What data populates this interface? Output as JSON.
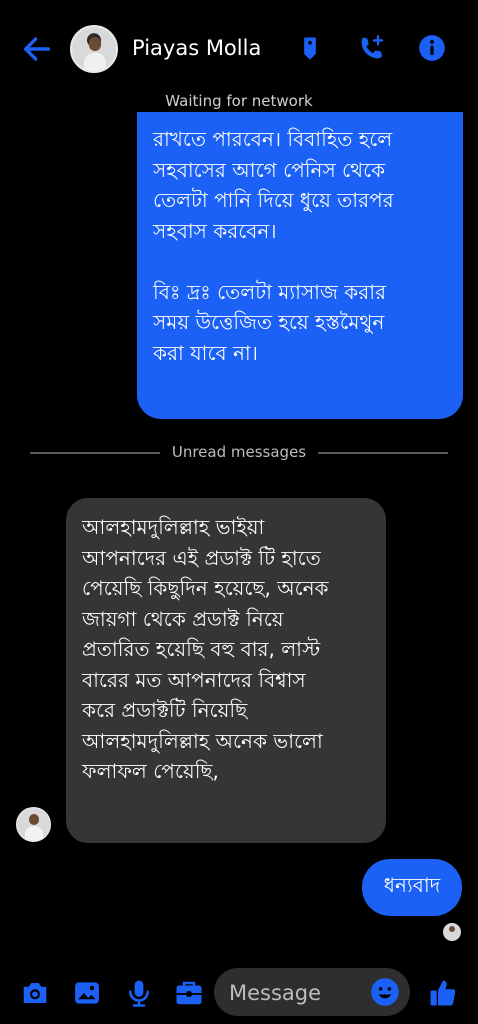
{
  "header": {
    "contact_name": "Piayas Molla",
    "status": "Waiting for network",
    "icons": [
      "back-arrow-icon",
      "tag-icon",
      "call-add-icon",
      "info-icon"
    ]
  },
  "messages": {
    "outgoing_top_text": "রাখতে পারবেন। বিবাহিত হলে\nসহবাসের আগে পেনিস থেকে\nতেলটা পানি দিয়ে ধুয়ে তারপর\nসহবাস করবেন।\n\nবিঃ দ্রঃ তেলটা ম্যাসাজ করার\nসময় উত্তেজিত হয়ে হস্তমৈথুন\nকরা যাবে না।",
    "divider_label": "Unread messages",
    "incoming_text": "আলহামদুলিল্লাহ ভাইয়া\nআপনাদের এই প্রডাক্ট টি হাতে\nপেয়েছি কিছুদিন হয়েছে, অনেক\nজায়গা থেকে প্রডাক্ট নিয়ে\nপ্রতারিত হয়েছি বহু বার, লাস্ট\nবারের মত আপনাদের বিশ্বাস\nকরে প্রডাক্টটি নিয়েছি\nআলহামদুলিল্লাহ অনেক ভালো\nফলাফল পেয়েছি,",
    "outgoing_small_text": "ধন্যবাদ"
  },
  "composer": {
    "placeholder": "Message",
    "icons": [
      "camera-icon",
      "gallery-icon",
      "microphone-icon",
      "toolbox-icon",
      "emoji-icon",
      "like-icon"
    ]
  },
  "colors": {
    "accent": "#1b61f5",
    "incoming_bubble": "#353535",
    "background": "#000000"
  }
}
